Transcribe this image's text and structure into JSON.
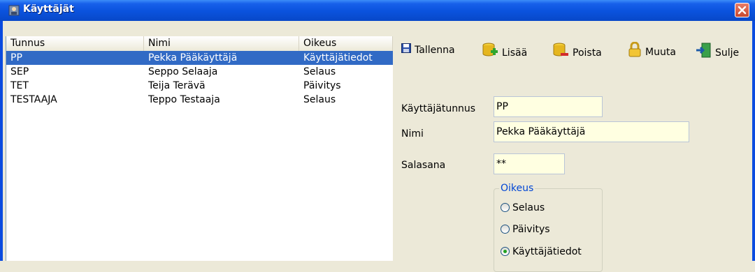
{
  "window": {
    "title": "Käyttäjät",
    "title_icon": "users-icon",
    "close_icon": "close-icon"
  },
  "list": {
    "columns": [
      "Tunnus",
      "Nimi",
      "Oikeus"
    ],
    "rows": [
      {
        "tunnus": "PP",
        "nimi": "Pekka Pääkäyttäjä",
        "oikeus": "Käyttäjätiedot",
        "selected": true
      },
      {
        "tunnus": "SEP",
        "nimi": "Seppo Selaaja",
        "oikeus": "Selaus",
        "selected": false
      },
      {
        "tunnus": "TET",
        "nimi": "Teija Terävä",
        "oikeus": "Päivitys",
        "selected": false
      },
      {
        "tunnus": "TESTAAJA",
        "nimi": "Teppo Testaaja",
        "oikeus": "Selaus",
        "selected": false
      }
    ]
  },
  "toolbar": {
    "save": {
      "label": "Tallenna",
      "icon": "floppy-disk-icon"
    },
    "add": {
      "label": "Lisää",
      "icon": "add-database-icon"
    },
    "delete": {
      "label": "Poista",
      "icon": "delete-database-icon"
    },
    "edit": {
      "label": "Muuta",
      "icon": "lock-icon"
    },
    "close": {
      "label": "Sulje",
      "icon": "exit-door-icon"
    }
  },
  "form": {
    "username_label": "Käyttäjätunnus",
    "username_value": "PP",
    "name_label": "Nimi",
    "name_value": "Pekka Pääkäyttäjä",
    "password_label": "Salasana",
    "password_value": "**",
    "rights_group_label": "Oikeus",
    "rights_options": [
      {
        "label": "Selaus",
        "checked": false
      },
      {
        "label": "Päivitys",
        "checked": false
      },
      {
        "label": "Käyttäjätiedot",
        "checked": true
      }
    ]
  },
  "colors": {
    "titlebar": "#0a52dd",
    "selection": "#316ac5",
    "field_background": "#ffffe1",
    "group_legend": "#0046d5"
  }
}
